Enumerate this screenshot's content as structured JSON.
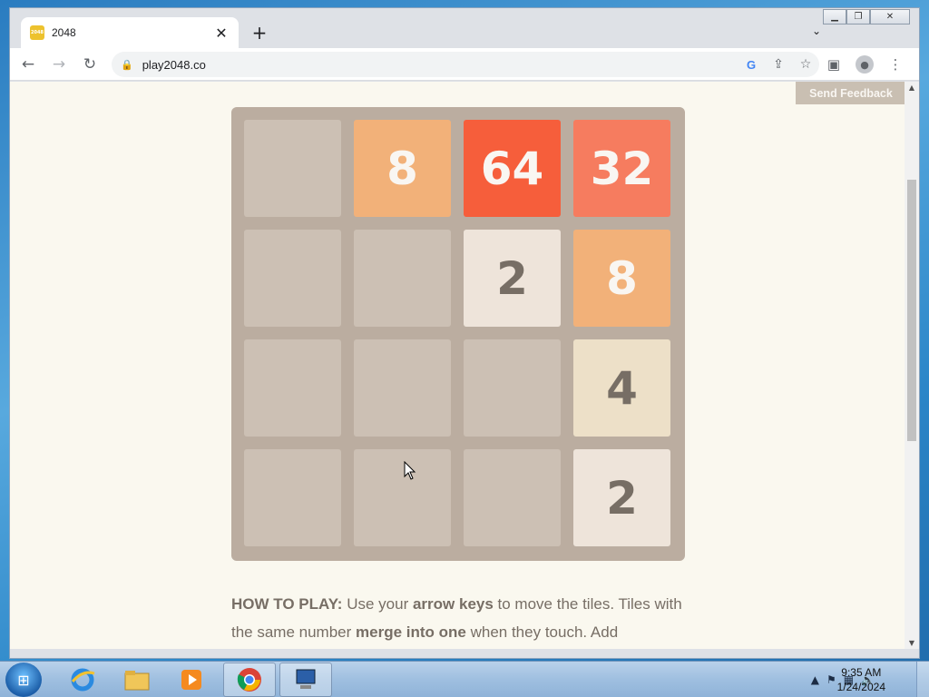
{
  "browser": {
    "tab_title": "2048",
    "tab_favicon_text": "2048",
    "url": "play2048.co",
    "new_tab_symbol": "+",
    "tab_close_symbol": "✕"
  },
  "page": {
    "feedback_label": "Send Feedback",
    "board": [
      [
        "",
        "8",
        "64",
        "32"
      ],
      [
        "",
        "",
        "2",
        "8"
      ],
      [
        "",
        "",
        "",
        "4"
      ],
      [
        "",
        "",
        "",
        "2"
      ]
    ],
    "howto": {
      "label": "HOW TO PLAY:",
      "t1": " Use your ",
      "b1": "arrow keys",
      "t2": " to move the tiles. Tiles with the same number ",
      "b2": "merge into one",
      "t3": " when they touch. Add"
    }
  },
  "taskbar": {
    "time": "9:35 AM",
    "date": "1/24/2024"
  },
  "colors": {
    "board_bg": "#bbada0",
    "page_bg": "#faf8ef",
    "tile_2": "#eee4da",
    "tile_4": "#ede0c8",
    "tile_8": "#f2b179",
    "tile_32": "#f67c5f",
    "tile_64": "#f65e3b"
  }
}
